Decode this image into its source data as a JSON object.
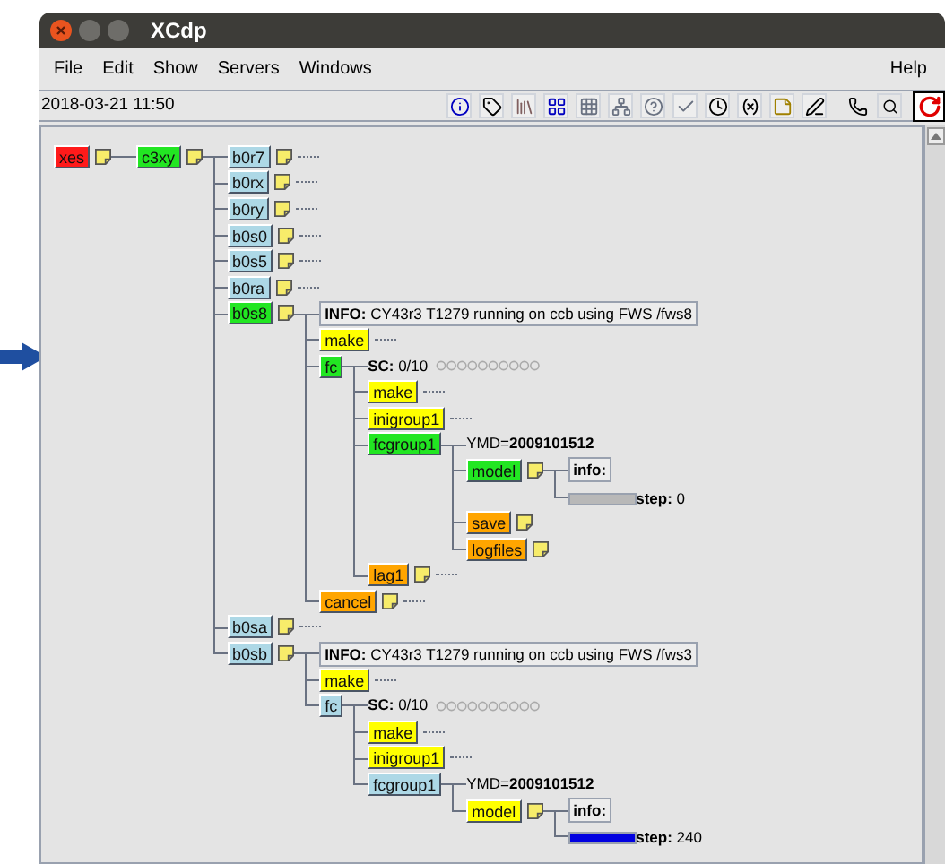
{
  "window": {
    "title": "XCdp"
  },
  "menu": [
    {
      "label": "File"
    },
    {
      "label": "Edit"
    },
    {
      "label": "Show"
    },
    {
      "label": "Servers"
    },
    {
      "label": "Windows"
    }
  ],
  "help_menu": {
    "label": "Help"
  },
  "toolbar": {
    "date": "2018-03-21 11:50"
  },
  "tree": [
    {
      "kind": "node",
      "name": "xes",
      "color": "#ff1a1a",
      "note": true,
      "children": [
        {
          "kind": "node",
          "name": "c3xy",
          "color": "#22e622",
          "note": true,
          "children": [
            {
              "kind": "node",
              "name": "b0r7",
              "color": "#add8e6",
              "note": true
            },
            {
              "kind": "node",
              "name": "b0rx",
              "color": "#add8e6",
              "note": true
            },
            {
              "kind": "node",
              "name": "b0ry",
              "color": "#add8e6",
              "note": true
            },
            {
              "kind": "node",
              "name": "b0s0",
              "color": "#add8e6",
              "note": true
            },
            {
              "kind": "node",
              "name": "b0s5",
              "color": "#add8e6",
              "note": true
            },
            {
              "kind": "node",
              "name": "b0ra",
              "color": "#add8e6",
              "note": true
            },
            {
              "kind": "node",
              "name": "b0s8",
              "color": "#22e622",
              "note": true,
              "children": [
                {
                  "kind": "info",
                  "text": "**INFO:** CY43r3 T1279 running on ccb using FWS /fws8"
                },
                {
                  "kind": "node",
                  "name": "make",
                  "color": "#ffff00",
                  "note": false
                },
                {
                  "kind": "node",
                  "name": "fc",
                  "color": "#22e622",
                  "note": false,
                  "children": [
                    {
                      "kind": "repeat",
                      "text": "**SC:** 0/10"
                    },
                    {
                      "kind": "node",
                      "name": "make",
                      "color": "#ffff00",
                      "note": false
                    },
                    {
                      "kind": "node",
                      "name": "inigroup1",
                      "color": "#ffff00",
                      "note": false
                    },
                    {
                      "kind": "node",
                      "name": "fcgroup1",
                      "color": "#22e622",
                      "note": false,
                      "children": [
                        {
                          "kind": "label",
                          "text": "YMD=**2009101512**"
                        },
                        {
                          "kind": "node",
                          "name": "model",
                          "color": "#22e622",
                          "note": true,
                          "children": [
                            {
                              "kind": "attr",
                              "text": "info:"
                            },
                            {
                              "kind": "meter",
                              "level": 0,
                              "text": "**step:** 0"
                            }
                          ]
                        },
                        {
                          "kind": "node",
                          "name": "save",
                          "color": "#ffa500",
                          "note": true,
                          "trail": false
                        },
                        {
                          "kind": "node",
                          "name": "logfiles",
                          "color": "#ffa500",
                          "note": true,
                          "trail": false
                        }
                      ]
                    },
                    {
                      "kind": "node",
                      "name": "lag1",
                      "color": "#ffa500",
                      "note": true
                    }
                  ]
                },
                {
                  "kind": "node",
                  "name": "cancel",
                  "color": "#ffa500",
                  "note": true
                }
              ]
            },
            {
              "kind": "node",
              "name": "b0sa",
              "color": "#add8e6",
              "note": true
            },
            {
              "kind": "node",
              "name": "b0sb",
              "color": "#add8e6",
              "note": true,
              "children": [
                {
                  "kind": "info",
                  "text": "**INFO:** CY43r3 T1279 running on ccb using FWS /fws3"
                },
                {
                  "kind": "node",
                  "name": "make",
                  "color": "#ffff00",
                  "note": false
                },
                {
                  "kind": "node",
                  "name": "fc",
                  "color": "#add8e6",
                  "note": false,
                  "children": [
                    {
                      "kind": "repeat",
                      "text": "**SC:** 0/10"
                    },
                    {
                      "kind": "node",
                      "name": "make",
                      "color": "#ffff00",
                      "note": false
                    },
                    {
                      "kind": "node",
                      "name": "inigroup1",
                      "color": "#ffff00",
                      "note": false
                    },
                    {
                      "kind": "node",
                      "name": "fcgroup1",
                      "color": "#add8e6",
                      "note": false,
                      "children": [
                        {
                          "kind": "label",
                          "text": "YMD=**2009101512**"
                        },
                        {
                          "kind": "node",
                          "name": "model",
                          "color": "#ffff00",
                          "note": true,
                          "children": [
                            {
                              "kind": "attr",
                              "text": "info:"
                            },
                            {
                              "kind": "meter",
                              "level": 1,
                              "text": "**step:** 240"
                            }
                          ]
                        }
                      ]
                    }
                  ]
                }
              ]
            }
          ]
        }
      ]
    }
  ]
}
